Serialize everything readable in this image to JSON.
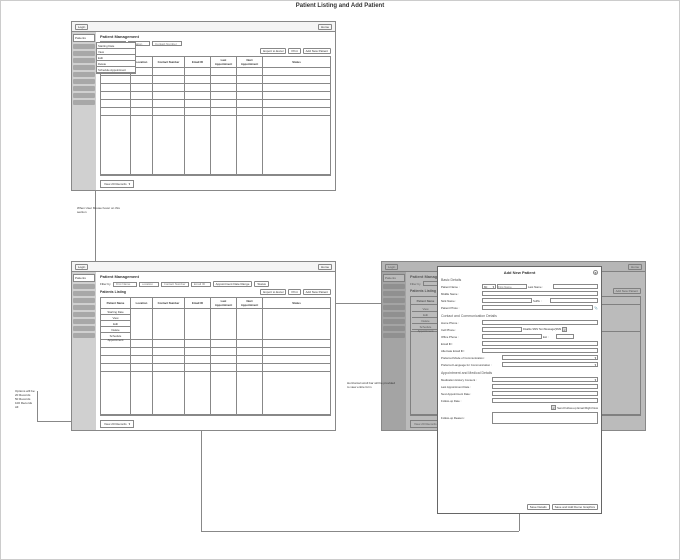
{
  "page_title": "Patient Listing and Add Patient",
  "topbar": {
    "login": "Login",
    "home": "Home"
  },
  "sidebar": {
    "top": "Patients"
  },
  "heading": "Patient Management",
  "filter": {
    "label": "Filter by",
    "first_name_ph": "First Name",
    "location_ph": "Location",
    "contact_ph": "Contact Number",
    "email_ph": "Email ID",
    "appt_btn": "Appointment Date Range",
    "status_btn": "Status"
  },
  "actions": {
    "export": "Export to Excel",
    "print": "Print",
    "add": "Add New Patient"
  },
  "listing_title": "Patients Listing",
  "columns": {
    "name": "Patient Name",
    "loc": "Location",
    "contact": "Contact Number",
    "email": "Email ID",
    "last": "Last Appointment",
    "next": "Next Appointment",
    "status": "Status"
  },
  "row_menu": {
    "starting": "Starting Date",
    "view": "View",
    "edit": "Edit",
    "delete": "Delete",
    "schedule": "Schedule Appointment"
  },
  "footer_dd": "View 20 Records",
  "notes": {
    "hover": "When User Mouse hover on this section",
    "options": "Options will be:\n20 Records\n50 Records\n100 Records\nAll",
    "scroll": "Horizontal scroll bar will be provided to view entire form"
  },
  "modal": {
    "title": "Add New Patient",
    "sec1": "Basic Details",
    "patient_name": "Patient Name :",
    "mr": "Mr.",
    "first": "First Name",
    "last": "Last Name :",
    "middle": "Middle Name :",
    "nick": "Nick Name :",
    "suffix": "Suffix :",
    "photo": "Patient Photo :",
    "sec2": "Contact and Communication Details",
    "home": "Home Phone :",
    "cell": "Cell Phone :",
    "disable_sms": "Disable SMS Text Message(SMS",
    "office": "Office Phone :",
    "ext": "Ext :",
    "email": "Email ID :",
    "alt_email": "Alternate Email ID :",
    "pref_mode": "Preferred Mode of Communication :",
    "pref_lang": "Preferred Language for Communication :",
    "sec3": "Appointment and Medical Details",
    "med_hist": "Medication History Consent :",
    "last_appt": "Last Appointment Date :",
    "next_appt": "Next Appointment Date :",
    "followup": "Follow-up Date :",
    "send_fu": "Send Follow-up Email Right Now",
    "fu_reason": "Follow-up Reason :",
    "save": "Save Details",
    "save_demo": "Save and Add Demo Graphics"
  }
}
